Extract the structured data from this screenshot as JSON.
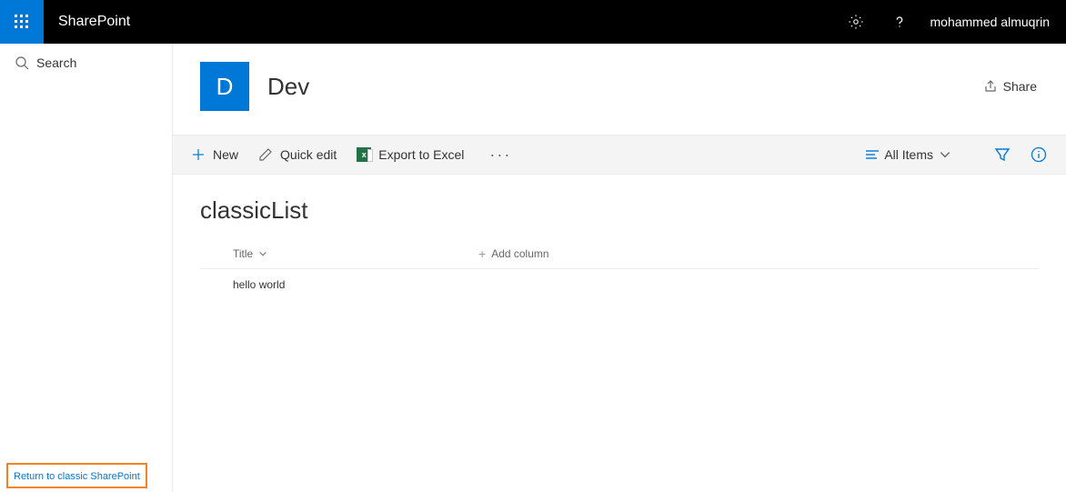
{
  "topbar": {
    "brand": "SharePoint",
    "username": "mohammed almuqrin"
  },
  "leftnav": {
    "search_placeholder": "Search",
    "return_link": "Return to classic SharePoint"
  },
  "site": {
    "logo_letter": "D",
    "name": "Dev",
    "share_label": "Share"
  },
  "cmdbar": {
    "new": "New",
    "quick_edit": "Quick edit",
    "export": "Export to Excel",
    "view": "All Items"
  },
  "list": {
    "title": "classicList",
    "columns": {
      "title": "Title",
      "add": "Add column"
    },
    "rows": [
      {
        "title": "hello world"
      }
    ]
  }
}
